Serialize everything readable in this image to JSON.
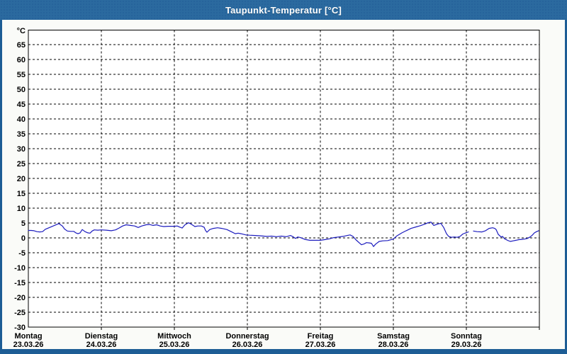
{
  "window": {
    "title": "Taupunkt-Temperatur [°C]"
  },
  "colors": {
    "titlebar": "#2b6a9f",
    "window_border": "#1d5d95",
    "page_background": "#fafbf8",
    "plot_background": "#ffffff",
    "grid": "#000000",
    "line": "#1c1cbe",
    "text": "#000000",
    "title_text": "#ffffff"
  },
  "chart_data": {
    "type": "line",
    "title": "Taupunkt-Temperatur [°C]",
    "legend": "none",
    "grid": {
      "style": "dashed",
      "horizontal_step": 5,
      "vertical": "one line per day"
    },
    "y_axis": {
      "unit": "°C",
      "min": -30,
      "max": 65,
      "step": 5,
      "tick_labels": [
        "65",
        "60",
        "55",
        "50",
        "45",
        "40",
        "35",
        "30",
        "25",
        "20",
        "15",
        "10",
        "5",
        "0",
        "-5",
        "-10",
        "-15",
        "-20",
        "-25",
        "-30"
      ]
    },
    "x_axis": {
      "unit": "days",
      "range_days": 7,
      "days": [
        {
          "name": "Montag",
          "date": "23.03.26"
        },
        {
          "name": "Dienstag",
          "date": "24.03.26"
        },
        {
          "name": "Mittwoch",
          "date": "25.03.26"
        },
        {
          "name": "Donnerstag",
          "date": "26.03.26"
        },
        {
          "name": "Freitag",
          "date": "27.03.26"
        },
        {
          "name": "Samstag",
          "date": "28.03.26"
        },
        {
          "name": "Sonntag",
          "date": "29.03.26"
        }
      ]
    },
    "series": [
      {
        "name": "Taupunkt-Temperatur",
        "color": "#1c1cbe",
        "x_unit": "days_since_monday_00h",
        "y_unit": "°C",
        "note": "two segments: short data gap early on Sonntag",
        "segments": [
          [
            [
              0.0,
              2.5
            ],
            [
              0.039,
              2.5
            ],
            [
              0.078,
              2.4
            ],
            [
              0.117,
              2.1
            ],
            [
              0.155,
              2.0
            ],
            [
              0.194,
              2.1
            ],
            [
              0.233,
              2.9
            ],
            [
              0.291,
              3.5
            ],
            [
              0.34,
              4.0
            ],
            [
              0.388,
              4.5
            ],
            [
              0.417,
              4.8
            ],
            [
              0.466,
              4.0
            ],
            [
              0.495,
              3.0
            ],
            [
              0.534,
              2.3
            ],
            [
              0.583,
              2.2
            ],
            [
              0.621,
              2.2
            ],
            [
              0.65,
              1.7
            ],
            [
              0.68,
              1.4
            ],
            [
              0.709,
              1.7
            ],
            [
              0.738,
              2.8
            ],
            [
              0.777,
              2.1
            ],
            [
              0.816,
              1.7
            ],
            [
              0.845,
              1.6
            ],
            [
              0.874,
              2.3
            ],
            [
              0.903,
              2.7
            ],
            [
              0.951,
              2.6
            ],
            [
              1.0,
              2.7
            ],
            [
              1.068,
              2.6
            ],
            [
              1.136,
              2.4
            ],
            [
              1.194,
              2.7
            ],
            [
              1.243,
              3.3
            ],
            [
              1.291,
              4.0
            ],
            [
              1.34,
              4.4
            ],
            [
              1.398,
              4.2
            ],
            [
              1.456,
              4.0
            ],
            [
              1.505,
              3.5
            ],
            [
              1.553,
              4.0
            ],
            [
              1.612,
              4.4
            ],
            [
              1.66,
              4.5
            ],
            [
              1.709,
              4.2
            ],
            [
              1.757,
              4.4
            ],
            [
              1.806,
              4.0
            ],
            [
              1.854,
              3.8
            ],
            [
              1.913,
              3.9
            ],
            [
              1.942,
              3.9
            ],
            [
              2.0,
              3.9
            ],
            [
              2.039,
              4.0
            ],
            [
              2.078,
              3.6
            ],
            [
              2.107,
              3.3
            ],
            [
              2.146,
              4.4
            ],
            [
              2.194,
              5.1
            ],
            [
              2.233,
              4.6
            ],
            [
              2.282,
              3.8
            ],
            [
              2.32,
              4.0
            ],
            [
              2.369,
              4.0
            ],
            [
              2.408,
              3.6
            ],
            [
              2.427,
              2.5
            ],
            [
              2.447,
              1.9
            ],
            [
              2.485,
              2.8
            ],
            [
              2.534,
              3.2
            ],
            [
              2.592,
              3.4
            ],
            [
              2.65,
              3.2
            ],
            [
              2.718,
              2.8
            ],
            [
              2.786,
              2.0
            ],
            [
              2.835,
              1.4
            ],
            [
              2.874,
              1.6
            ],
            [
              2.913,
              1.4
            ],
            [
              2.981,
              1.0
            ],
            [
              3.029,
              0.9
            ],
            [
              3.107,
              0.8
            ],
            [
              3.184,
              0.7
            ],
            [
              3.262,
              0.5
            ],
            [
              3.33,
              0.6
            ],
            [
              3.398,
              0.4
            ],
            [
              3.466,
              0.6
            ],
            [
              3.534,
              0.4
            ],
            [
              3.592,
              0.8
            ],
            [
              3.631,
              0.3
            ],
            [
              3.66,
              -0.2
            ],
            [
              3.689,
              0.3
            ],
            [
              3.728,
              0.1
            ],
            [
              3.786,
              -0.5
            ],
            [
              3.854,
              -0.8
            ],
            [
              3.922,
              -0.8
            ],
            [
              4.0,
              -0.8
            ],
            [
              4.058,
              -0.6
            ],
            [
              4.126,
              -0.3
            ],
            [
              4.184,
              0.1
            ],
            [
              4.252,
              0.3
            ],
            [
              4.311,
              0.5
            ],
            [
              4.369,
              0.8
            ],
            [
              4.408,
              1.0
            ],
            [
              4.447,
              0.5
            ],
            [
              4.485,
              -0.6
            ],
            [
              4.534,
              -1.7
            ],
            [
              4.563,
              -2.3
            ],
            [
              4.602,
              -2.0
            ],
            [
              4.631,
              -1.6
            ],
            [
              4.67,
              -1.7
            ],
            [
              4.699,
              -1.8
            ],
            [
              4.728,
              -2.9
            ],
            [
              4.757,
              -2.1
            ],
            [
              4.806,
              -1.2
            ],
            [
              4.854,
              -1.0
            ],
            [
              4.922,
              -0.9
            ],
            [
              5.0,
              -0.4
            ],
            [
              5.049,
              0.7
            ],
            [
              5.117,
              1.7
            ],
            [
              5.175,
              2.4
            ],
            [
              5.243,
              3.2
            ],
            [
              5.311,
              3.7
            ],
            [
              5.369,
              4.1
            ],
            [
              5.437,
              4.7
            ],
            [
              5.476,
              5.1
            ],
            [
              5.515,
              5.3
            ],
            [
              5.553,
              4.2
            ],
            [
              5.612,
              4.7
            ],
            [
              5.65,
              4.9
            ],
            [
              5.689,
              3.5
            ],
            [
              5.728,
              1.4
            ],
            [
              5.757,
              0.5
            ],
            [
              5.796,
              0.2
            ],
            [
              5.835,
              0.3
            ],
            [
              5.874,
              0.2
            ],
            [
              5.913,
              0.5
            ],
            [
              5.951,
              1.3
            ],
            [
              5.99,
              1.7
            ],
            [
              6.029,
              2.0
            ]
          ],
          [
            [
              6.097,
              2.3
            ],
            [
              6.146,
              2.1
            ],
            [
              6.214,
              2.0
            ],
            [
              6.262,
              2.4
            ],
            [
              6.311,
              3.2
            ],
            [
              6.359,
              3.4
            ],
            [
              6.388,
              3.2
            ],
            [
              6.408,
              2.8
            ],
            [
              6.437,
              1.2
            ],
            [
              6.476,
              0.3
            ],
            [
              6.495,
              0.5
            ],
            [
              6.524,
              -0.3
            ],
            [
              6.563,
              -0.8
            ],
            [
              6.602,
              -1.2
            ],
            [
              6.641,
              -1.0
            ],
            [
              6.68,
              -0.8
            ],
            [
              6.718,
              -0.6
            ],
            [
              6.757,
              -0.5
            ],
            [
              6.796,
              -0.4
            ],
            [
              6.835,
              -0.2
            ],
            [
              6.874,
              0.3
            ],
            [
              6.903,
              0.9
            ],
            [
              6.932,
              1.7
            ],
            [
              6.961,
              2.1
            ],
            [
              6.99,
              2.4
            ]
          ]
        ]
      }
    ]
  }
}
